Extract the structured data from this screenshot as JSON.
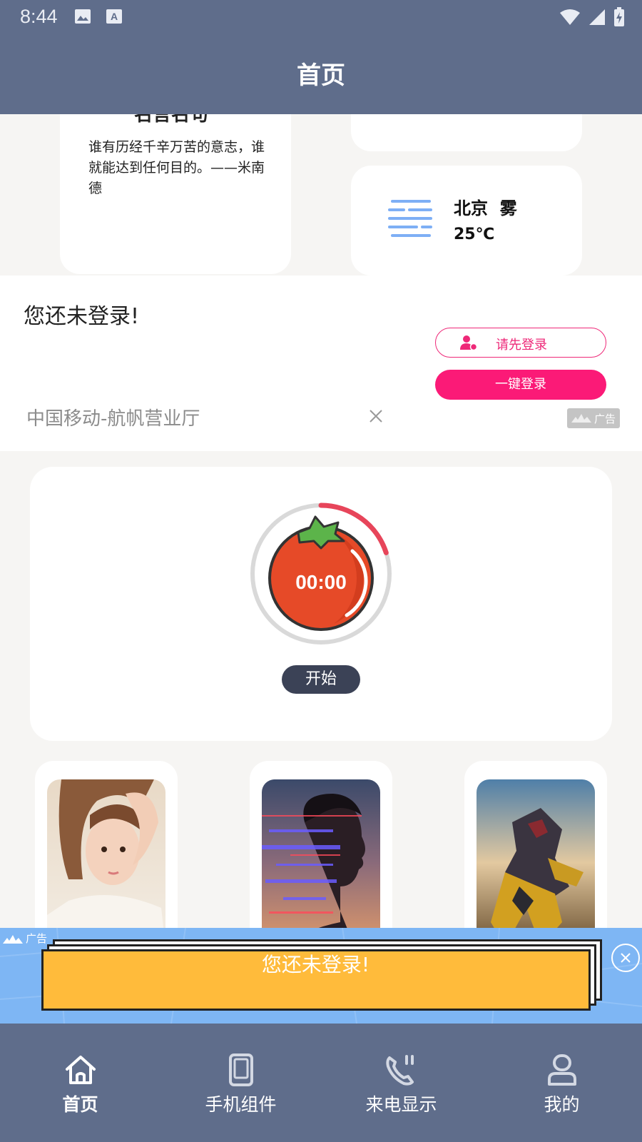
{
  "status_bar": {
    "time": "8:44",
    "icons": [
      "image-icon",
      "a-text-icon",
      "wifi-icon",
      "signal-icon",
      "battery-charging-icon"
    ]
  },
  "header": {
    "title": "首页"
  },
  "quote_card": {
    "title": "名言名句",
    "text": "谁有历经千辛万苦的意志，谁就能达到任何目的。——米南德"
  },
  "weather_card": {
    "city_weather": "北京  雾",
    "temperature": "25℃",
    "icon": "fog-icon"
  },
  "login_ad": {
    "not_logged_in": "您还未登录!",
    "login_first_button": "请先登录",
    "one_click_button": "一键登录",
    "carrier": "中国移动-航帆营业厅",
    "ad_label": "广告"
  },
  "timer": {
    "time": "00:00",
    "start_button": "开始",
    "progress_fraction": 0.2
  },
  "wallpapers": [
    {
      "name": "wallpaper-girl"
    },
    {
      "name": "wallpaper-glitch-man"
    },
    {
      "name": "wallpaper-robot"
    }
  ],
  "bottom_ad": {
    "ad_label": "广告",
    "text": "您还未登录!"
  },
  "nav": [
    {
      "label": "首页",
      "icon": "home-icon",
      "active": true
    },
    {
      "label": "手机组件",
      "icon": "phone-icon",
      "active": false
    },
    {
      "label": "来电显示",
      "icon": "incoming-call-icon",
      "active": false
    },
    {
      "label": "我的",
      "icon": "user-icon",
      "active": false
    }
  ],
  "colors": {
    "header_bg": "#5f6d8b",
    "accent_pink": "#fb1a77",
    "timer_red": "#e7455a",
    "ad_yellow": "#ffbb3b"
  }
}
